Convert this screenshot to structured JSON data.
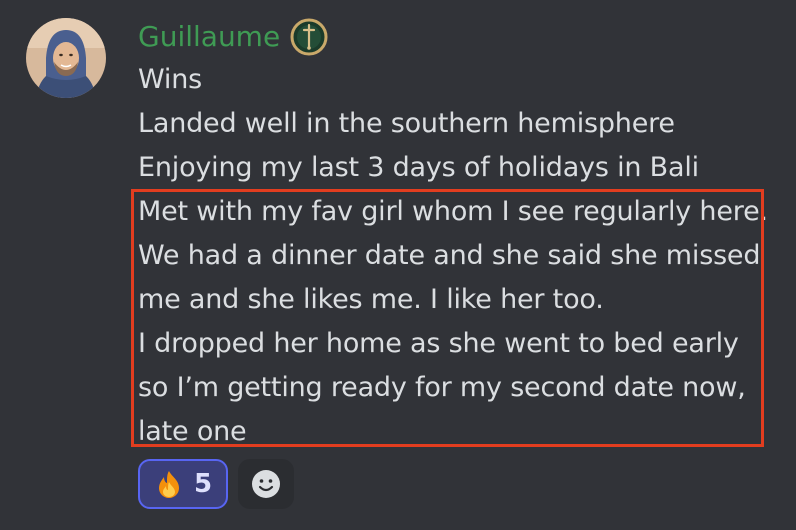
{
  "author": {
    "username": "Guillaume",
    "avatar_icon": "user-avatar",
    "badge_icon": "sword-role-icon",
    "name_color": "#3f9b54"
  },
  "message": {
    "lines": [
      "Wins",
      "Landed well in the southern hemisphere",
      "Enjoying my last 3 days of holidays in Bali",
      "Met with my fav girl whom I see regularly here.",
      "We had a dinner date and she said she missed",
      "me and she likes me. I like her too.",
      "I dropped her home as she went to bed early",
      "so I’m getting ready for my second date now,",
      "late one"
    ],
    "highlight_color": "#e23d1f"
  },
  "reactions": [
    {
      "emoji_icon": "fire-emoji-icon",
      "count": "5"
    }
  ],
  "add_reaction_icon": "smiley-add-reaction-icon"
}
